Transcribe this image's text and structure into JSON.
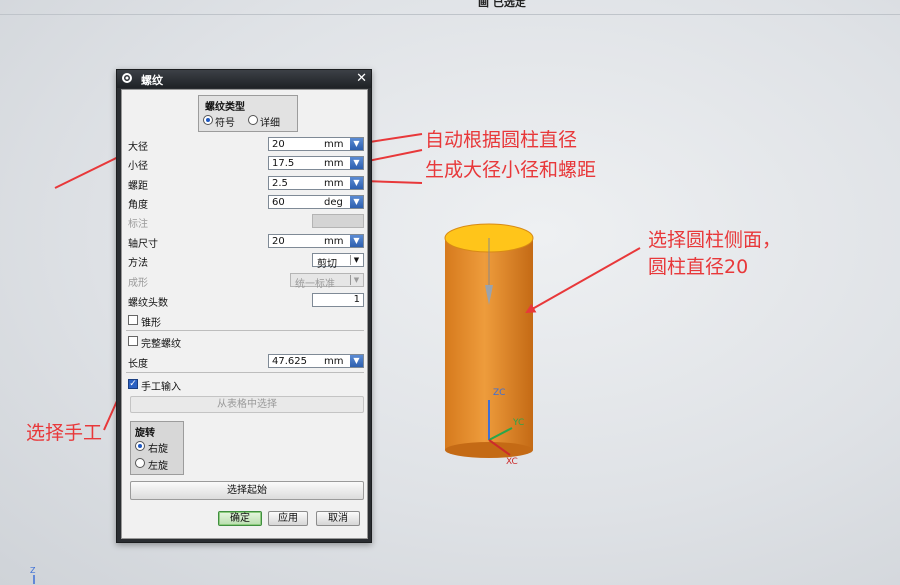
{
  "window_title": "画 已选定",
  "dialog": {
    "title": "螺纹",
    "thread_type": {
      "title": "螺纹类型",
      "option_symbol": "符号",
      "option_detail": "详细",
      "selected": "符号"
    },
    "major_diameter": {
      "label": "大径",
      "value": "20",
      "unit": "mm"
    },
    "minor_diameter": {
      "label": "小径",
      "value": "17.5",
      "unit": "mm"
    },
    "pitch": {
      "label": "螺距",
      "value": "2.5",
      "unit": "mm"
    },
    "angle": {
      "label": "角度",
      "value": "60",
      "unit": "deg"
    },
    "callout": {
      "label": "标注"
    },
    "shaft_size": {
      "label": "轴尺寸",
      "value": "20",
      "unit": "mm"
    },
    "method": {
      "label": "方法",
      "value": "剪切"
    },
    "form": {
      "label": "成形",
      "value": "统一标准"
    },
    "number_of_starts": {
      "label": "螺纹头数",
      "value": "1"
    },
    "tapered": {
      "label": "锥形",
      "checked": false
    },
    "full_thread": {
      "label": "完整螺纹",
      "checked": false
    },
    "length": {
      "label": "长度",
      "value": "47.625",
      "unit": "mm"
    },
    "manual_input": {
      "label": "手工输入",
      "checked": true
    },
    "choose_from_table": "从表格中选择",
    "rotation": {
      "title": "旋转",
      "right": "右旋",
      "left": "左旋",
      "selected": "右旋"
    },
    "select_start": "选择起始",
    "ok": "确定",
    "apply": "应用",
    "cancel": "取消"
  },
  "annotations": {
    "auto_line1": "自动根据圆柱直径",
    "auto_line2": "生成大径小径和螺距",
    "select_cylinder_line1": "选择圆柱侧面，",
    "select_cylinder_line2": "圆柱直径20",
    "select_manual": "选择手工"
  },
  "triad": {
    "zc": "ZC",
    "yc": "YC",
    "xc": "XC"
  },
  "corner_axis": "Z",
  "colors": {
    "annotation_red": "#e8383a",
    "cylinder_orange": "#e5902f",
    "cylinder_top": "#ffc51a",
    "dialog_dark": "#2a2d31",
    "spin_blue": "#2d5fae"
  }
}
